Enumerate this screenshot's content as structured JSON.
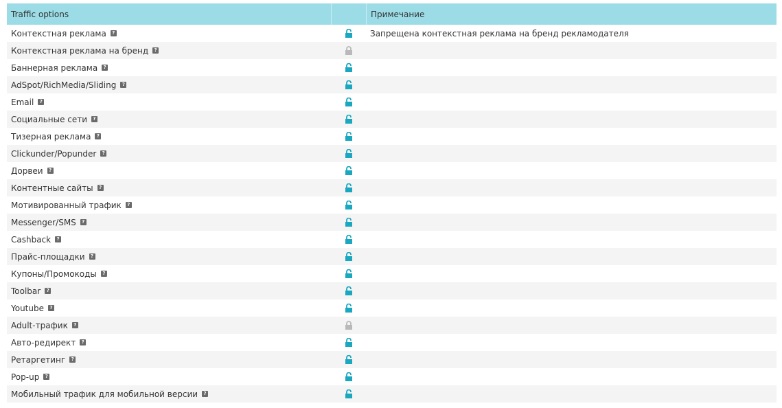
{
  "header": {
    "col_options": "Traffic options",
    "col_note": "Примечание"
  },
  "colors": {
    "header_bg": "#9bdce6",
    "allowed_lock": "#1aa7c0",
    "denied_lock": "#b9b9b9"
  },
  "rows": [
    {
      "label": "Контекстная реклама",
      "status": "allowed",
      "note": "Запрещена контекстная реклама на бренд рекламодателя"
    },
    {
      "label": "Контекстная реклама на бренд",
      "status": "denied",
      "note": ""
    },
    {
      "label": "Баннерная реклама",
      "status": "allowed",
      "note": ""
    },
    {
      "label": "AdSpot/RichMedia/Sliding",
      "status": "allowed",
      "note": ""
    },
    {
      "label": "Email",
      "status": "allowed",
      "note": ""
    },
    {
      "label": "Социальные сети",
      "status": "allowed",
      "note": ""
    },
    {
      "label": "Тизерная реклама",
      "status": "allowed",
      "note": ""
    },
    {
      "label": "Clickunder/Popunder",
      "status": "allowed",
      "note": ""
    },
    {
      "label": "Дорвеи",
      "status": "allowed",
      "note": ""
    },
    {
      "label": "Контентные сайты",
      "status": "allowed",
      "note": ""
    },
    {
      "label": "Мотивированный трафик",
      "status": "allowed",
      "note": ""
    },
    {
      "label": "Messenger/SMS",
      "status": "allowed",
      "note": ""
    },
    {
      "label": "Cashback",
      "status": "allowed",
      "note": ""
    },
    {
      "label": "Прайс-площадки",
      "status": "allowed",
      "note": ""
    },
    {
      "label": "Купоны/Промокоды",
      "status": "allowed",
      "note": ""
    },
    {
      "label": "Toolbar",
      "status": "allowed",
      "note": ""
    },
    {
      "label": "Youtube",
      "status": "allowed",
      "note": ""
    },
    {
      "label": "Adult-трафик",
      "status": "denied",
      "note": ""
    },
    {
      "label": "Авто-редирект",
      "status": "allowed",
      "note": ""
    },
    {
      "label": "Ретаргетинг",
      "status": "allowed",
      "note": ""
    },
    {
      "label": "Pop-up",
      "status": "allowed",
      "note": ""
    },
    {
      "label": "Мобильный трафик для мобильной версии",
      "status": "allowed",
      "note": ""
    }
  ],
  "help_icon_glyph": "?"
}
